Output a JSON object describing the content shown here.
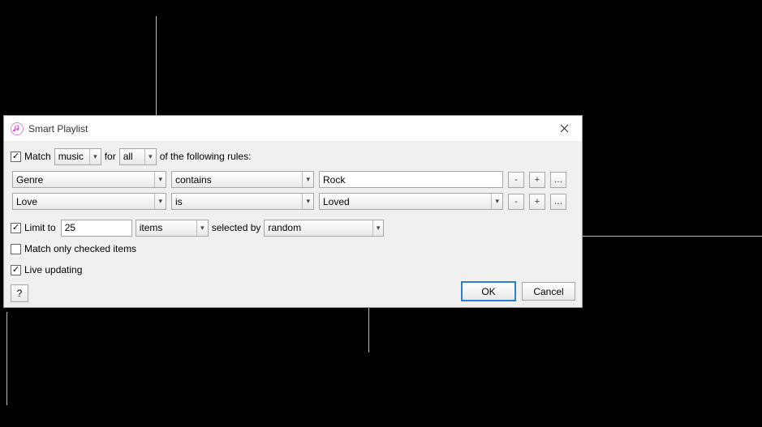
{
  "titlebar": {
    "title": "Smart Playlist"
  },
  "match": {
    "checkbox_label": "Match",
    "media_type": "music",
    "for_label": "for",
    "scope": "all",
    "tail_label": "of the following rules:"
  },
  "rules": [
    {
      "field": "Genre",
      "operator": "contains",
      "value": "Rock",
      "value_type": "text"
    },
    {
      "field": "Love",
      "operator": "is",
      "value": "Loved",
      "value_type": "select"
    }
  ],
  "limit": {
    "checkbox_label": "Limit to",
    "count": "25",
    "unit": "items",
    "selected_by_label": "selected by",
    "method": "random"
  },
  "match_checked_label": "Match only checked items",
  "live_updating_label": "Live updating",
  "help_label": "?",
  "buttons": {
    "ok": "OK",
    "cancel": "Cancel"
  },
  "icon_note": "♫"
}
